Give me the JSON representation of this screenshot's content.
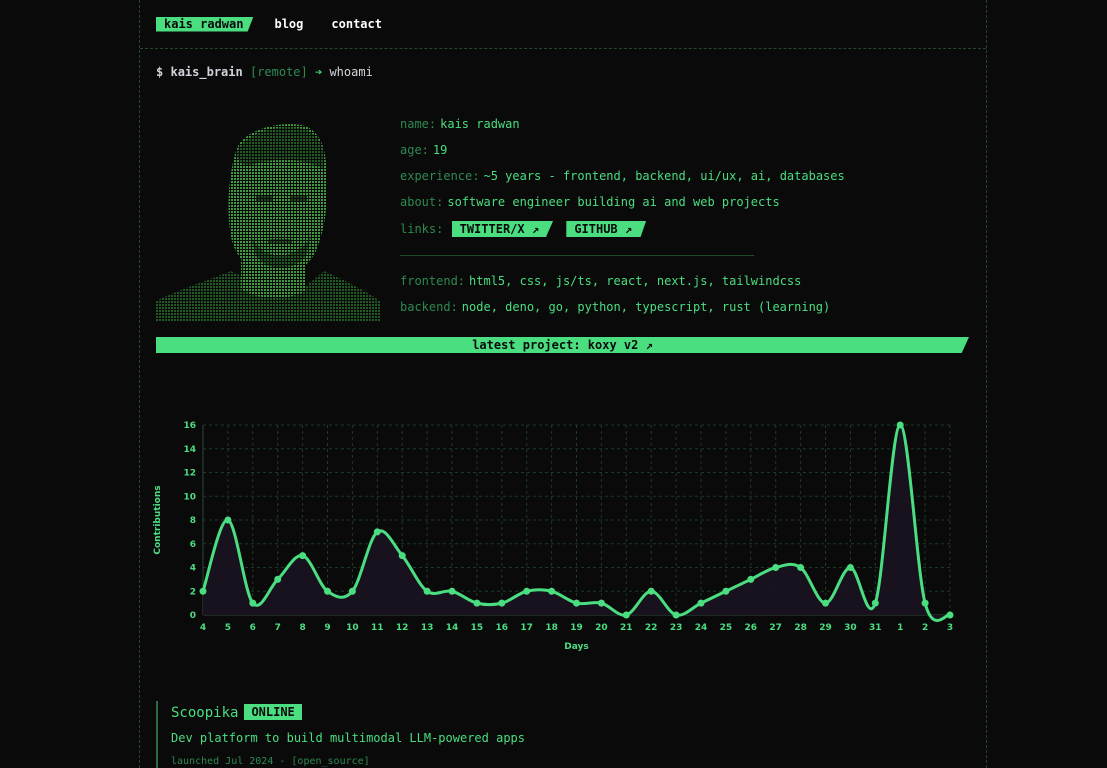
{
  "nav": {
    "brand": "kais radwan",
    "links": [
      "blog",
      "contact"
    ]
  },
  "prompt": {
    "symbol": "$",
    "host": "kais_brain",
    "remote": "[remote]",
    "arrow": "➔",
    "command": "whoami"
  },
  "profile": {
    "portrait_icon": "ascii-portrait",
    "name_key": "name:",
    "name": "kais radwan",
    "age_key": "age:",
    "age": "19",
    "experience_key": "experience:",
    "experience": "~5 years - frontend, backend, ui/ux, ai, databases",
    "about_key": "about:",
    "about": "software engineer building ai and web projects",
    "links_key": "links:",
    "links": [
      "TWITTER/X ↗",
      "GITHUB ↗"
    ],
    "frontend_key": "frontend:",
    "frontend": "html5, css, js/ts, react, next.js, tailwindcss",
    "backend_key": "backend:",
    "backend": "node, deno, go, python, typescript, rust (learning)"
  },
  "banner": "latest project: koxy v2 ↗",
  "chart_data": {
    "type": "line",
    "xlabel": "Days",
    "ylabel": "Contributions",
    "categories": [
      "4",
      "5",
      "6",
      "7",
      "8",
      "9",
      "10",
      "11",
      "12",
      "13",
      "14",
      "15",
      "16",
      "17",
      "18",
      "19",
      "20",
      "21",
      "22",
      "23",
      "24",
      "25",
      "26",
      "27",
      "28",
      "29",
      "30",
      "31",
      "1",
      "2",
      "3"
    ],
    "values": [
      2,
      8,
      1,
      3,
      5,
      2,
      2,
      7,
      5,
      2,
      2,
      1,
      1,
      2,
      2,
      1,
      1,
      0,
      2,
      0,
      1,
      2,
      3,
      4,
      4,
      1,
      4,
      1,
      16,
      1,
      0
    ],
    "ylim": [
      0,
      16
    ],
    "yticks": [
      0,
      2,
      4,
      6,
      8,
      10,
      12,
      14,
      16
    ],
    "grid": true,
    "color": "#4ade80"
  },
  "project": {
    "name": "Scoopika",
    "status": "ONLINE",
    "description": "Dev platform to build multimodal LLM-powered apps",
    "meta": "launched Jul 2024 - [open_source]"
  },
  "colors": {
    "background": "#0a0a0a",
    "accent": "#4ade80",
    "muted": "#2d8a50"
  }
}
